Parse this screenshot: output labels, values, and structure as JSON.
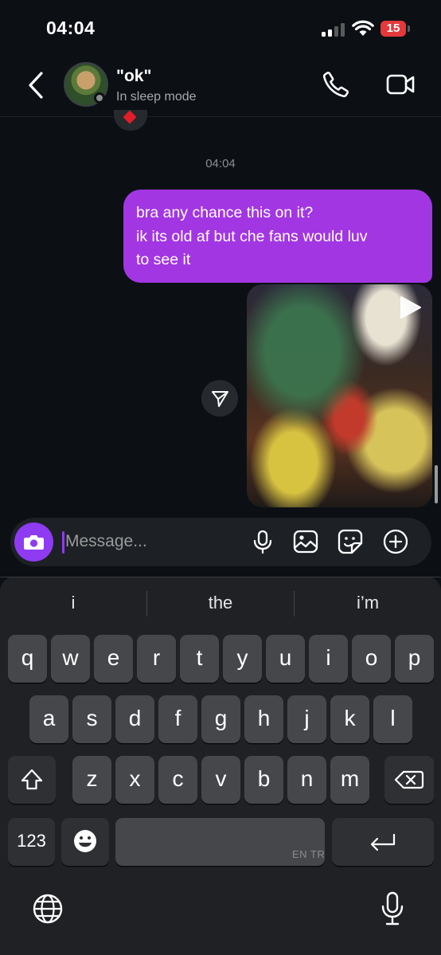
{
  "status_bar": {
    "time": "04:04",
    "battery": "15"
  },
  "header": {
    "name": "\"ok\"",
    "status": "In sleep mode"
  },
  "chat": {
    "timestamp": "04:04",
    "message_lines": [
      "bra any chance this on it?",
      "ik its old af but che fans would luv",
      "to see it"
    ]
  },
  "composer": {
    "placeholder": "Message..."
  },
  "keyboard": {
    "suggestions": [
      "i",
      "the",
      "i’m"
    ],
    "row1": [
      "q",
      "w",
      "e",
      "r",
      "t",
      "y",
      "u",
      "i",
      "o",
      "p"
    ],
    "row2": [
      "a",
      "s",
      "d",
      "f",
      "g",
      "h",
      "j",
      "k",
      "l"
    ],
    "row3": [
      "z",
      "x",
      "c",
      "v",
      "b",
      "n",
      "m"
    ],
    "numbers_label": "123",
    "space_label": "EN TR"
  },
  "colors": {
    "accent": "#a236e3",
    "camera": "#8e3bf2",
    "background": "#0c1014",
    "battery": "#e5383b"
  }
}
